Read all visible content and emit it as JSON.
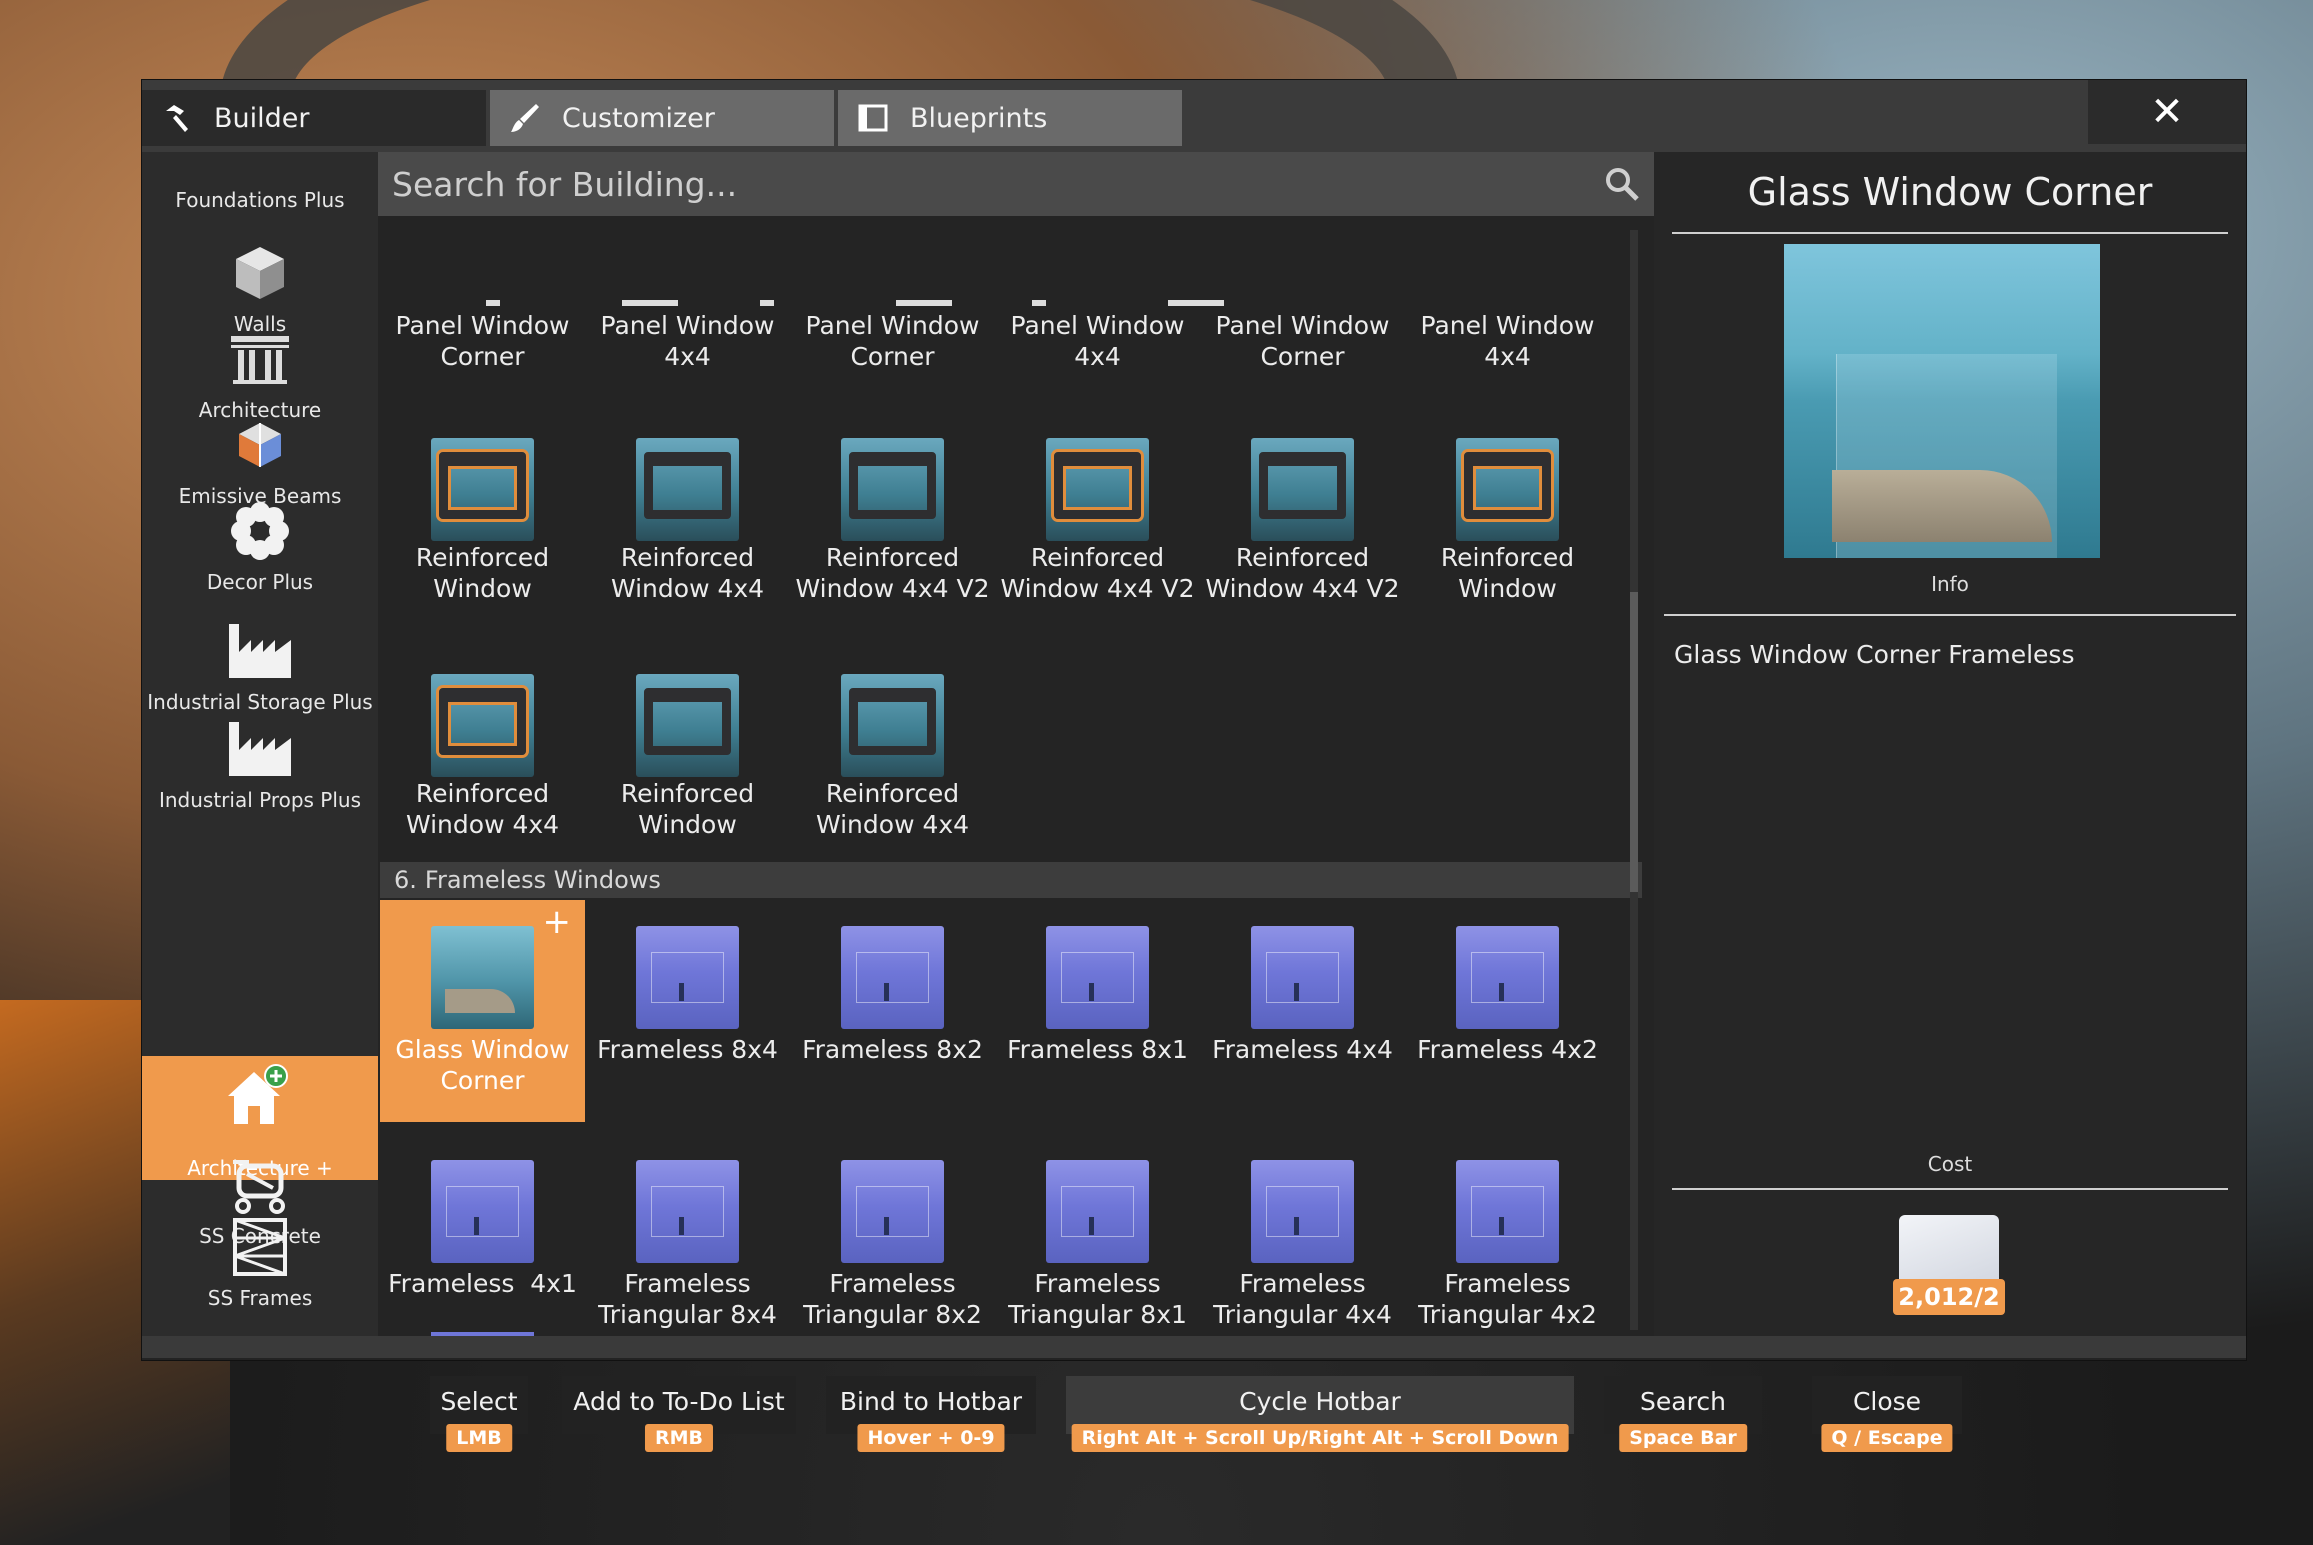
{
  "tabs": [
    {
      "label": "Builder",
      "icon": "hammer-icon"
    },
    {
      "label": "Customizer",
      "icon": "paintbrush-icon"
    },
    {
      "label": "Blueprints",
      "icon": "blueprint-icon"
    }
  ],
  "close_label": "✕",
  "sidebar": {
    "items": [
      {
        "label": "Foundations Plus",
        "icon": "foundation-icon"
      },
      {
        "label": "Walls",
        "icon": "cube-icon"
      },
      {
        "label": "Architecture",
        "icon": "pillars-icon"
      },
      {
        "label": "Emissive Beams",
        "icon": "beam-cube-icon"
      },
      {
        "label": "Decor Plus",
        "icon": "flower-icon"
      },
      {
        "label": "Industrial Storage Plus",
        "icon": "factory-icon"
      },
      {
        "label": "Industrial Props Plus",
        "icon": "factory-icon"
      },
      {
        "label": "Architecture +",
        "icon": "house-plus-icon",
        "active": true
      },
      {
        "label": "SS Concrete",
        "icon": "concrete-mixer-icon"
      },
      {
        "label": "SS Frames",
        "icon": "scaffold-icon"
      }
    ]
  },
  "search": {
    "placeholder": "Search for Building..."
  },
  "grid": {
    "row_top": [
      "Panel Window Corner",
      "Panel Window 4x4",
      "Panel Window Corner",
      "Panel Window 4x4",
      "Panel Window Corner",
      "Panel Window 4x4"
    ],
    "row_reinforced_1": [
      "Reinforced Window",
      "Reinforced Window 4x4",
      "Reinforced Window 4x4 V2",
      "Reinforced Window 4x4 V2",
      "Reinforced Window 4x4 V2",
      "Reinforced Window"
    ],
    "row_reinforced_2": [
      "Reinforced Window 4x4",
      "Reinforced Window",
      "Reinforced Window 4x4"
    ],
    "section": {
      "number": "6.",
      "title": "Frameless Windows"
    },
    "row_frameless_1": [
      "Glass Window Corner",
      "Frameless 8x4",
      "Frameless 8x2",
      "Frameless 8x1",
      "Frameless 4x4",
      "Frameless 4x2"
    ],
    "row_frameless_2": [
      "Frameless  4x1",
      "Frameless Triangular 8x4",
      "Frameless Triangular 8x2",
      "Frameless Triangular 8x1",
      "Frameless Triangular 4x4",
      "Frameless Triangular 4x2"
    ],
    "selected": "Glass Window Corner",
    "selected_badge": "+"
  },
  "details": {
    "title": "Glass Window Corner",
    "info_label": "Info",
    "description": "Glass Window Corner Frameless",
    "cost_label": "Cost",
    "cost_value": "2,012/2"
  },
  "hints": [
    {
      "action": "Select",
      "key": "LMB"
    },
    {
      "action": "Add to To-Do List",
      "key": "RMB"
    },
    {
      "action": "Bind to Hotbar",
      "key": "Hover + 0-9"
    },
    {
      "action": "Cycle Hotbar",
      "key": "Right Alt + Scroll Up/Right Alt + Scroll Down"
    },
    {
      "action": "Search",
      "key": "Space Bar"
    },
    {
      "action": "Close",
      "key": "Q / Escape"
    }
  ],
  "colors": {
    "accent": "#f09a4c",
    "panel": "#232323",
    "sidebar": "#2c2c2c"
  }
}
